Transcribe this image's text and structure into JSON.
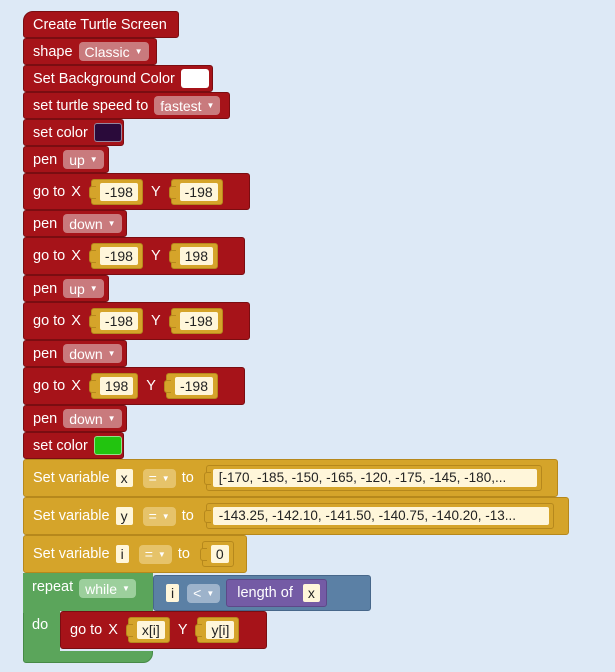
{
  "blocks": {
    "create_screen": "Create Turtle Screen",
    "shape_label": "shape",
    "shape_value": "Classic",
    "bg_label": "Set Background Color",
    "speed_label": "set turtle speed to",
    "speed_value": "fastest",
    "set_color_label": "set color",
    "pen_label": "pen",
    "pen_up": "up",
    "pen_down": "down",
    "goto_label": "go to",
    "x_label": "X",
    "y_label": "Y",
    "goto1": {
      "x": "-198",
      "y": "-198"
    },
    "goto2": {
      "x": "-198",
      "y": "198"
    },
    "goto3": {
      "x": "-198",
      "y": "-198"
    },
    "goto4": {
      "x": "198",
      "y": "-198"
    },
    "set_variable_label": "Set variable",
    "eq": "=",
    "to_label": "to",
    "var_x": "x",
    "var_y": "y",
    "var_i": "i",
    "x_list": "[-170, -185, -150, -165, -120, -175, -145, -180,...",
    "y_list": "-143.25, -142.10, -141.50, -140.75, -140.20, -13...",
    "i_value": "0",
    "repeat_label": "repeat",
    "repeat_mode": "while",
    "lt": "<",
    "length_of": "length of",
    "do_label": "do",
    "loop_x": "x[i]",
    "loop_y": "y[i]"
  },
  "colors": {
    "red": "#a61319",
    "gold": "#d5a42a",
    "green": "#5ba55b",
    "blue": "#5b80a5",
    "purple": "#745ba5",
    "set_color_1": "#2a0a3a",
    "set_color_2": "#22c40f",
    "background_color": "#ffffff"
  }
}
